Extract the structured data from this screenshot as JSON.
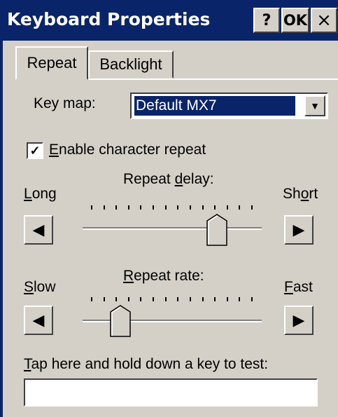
{
  "window": {
    "title": "Keyboard Properties",
    "help_label": "?",
    "ok_label": "OK",
    "close_label": "×"
  },
  "tabs": [
    {
      "label": "Repeat",
      "selected": true
    },
    {
      "label": "Backlight",
      "selected": false
    }
  ],
  "keymap": {
    "label": "Key map:",
    "value": "Default MX7"
  },
  "enable_repeat": {
    "checked": true,
    "mnemonic": "E",
    "label_rest": "nable character repeat"
  },
  "repeat_delay": {
    "title_pre": "Repeat ",
    "title_mnemonic": "d",
    "title_post": "elay:",
    "left_mnemonic": "L",
    "left_rest": "ong",
    "right_pre": "Sh",
    "right_mnemonic": "o",
    "right_post": "rt",
    "position_fraction": 0.78,
    "tick_count": 14
  },
  "repeat_rate": {
    "title_mnemonic": "R",
    "title_rest": "epeat rate:",
    "left_mnemonic": "S",
    "left_rest": "low",
    "right_mnemonic": "F",
    "right_rest": "ast",
    "position_fraction": 0.18,
    "tick_count": 14
  },
  "test": {
    "label_mnemonic": "T",
    "label_rest": "ap here and hold down a key to test:",
    "value": ""
  },
  "icons": {
    "left_arrow": "◀",
    "right_arrow": "▶",
    "dropdown": "▼",
    "check": "✓"
  }
}
